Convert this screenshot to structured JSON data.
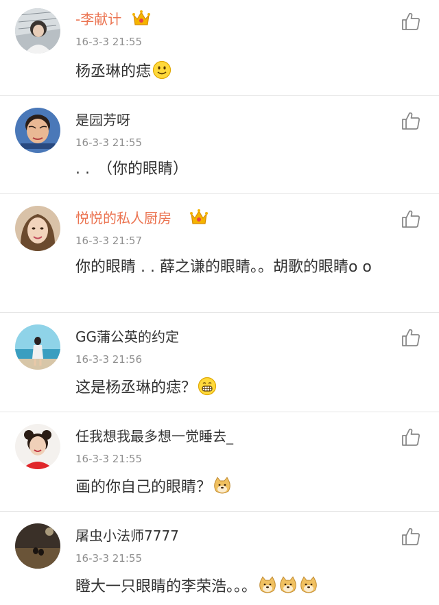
{
  "comments": [
    {
      "username": "-李献计",
      "vip": true,
      "timestamp": "16-3-3 21:55",
      "text": "杨丞琳的痣",
      "emoji": [
        "smile-emoji"
      ],
      "avatar_color": "#9aa3a8"
    },
    {
      "username": "是园芳呀",
      "vip": false,
      "timestamp": "16-3-3 21:55",
      "text": ". .　（你的眼睛）",
      "emoji": [],
      "avatar_color": "#6b8fbf"
    },
    {
      "username": "悦悦的私人厨房",
      "vip": true,
      "timestamp": "16-3-3 21:57",
      "text": "你的眼睛 . . 薛之谦的眼睛。。胡歌的眼睛o o",
      "emoji": [],
      "avatar_color": "#c9a07a"
    },
    {
      "username": "GG蒲公英的约定",
      "vip": false,
      "timestamp": "16-3-3 21:56",
      "text": "这是杨丞琳的痣？",
      "emoji": [
        "grin-emoji"
      ],
      "avatar_color": "#5fb2c7"
    },
    {
      "username": "任我想我最多想一觉睡去_",
      "vip": false,
      "timestamp": "16-3-3 21:55",
      "text": "画的你自己的眼睛？",
      "emoji": [
        "doge-emoji"
      ],
      "avatar_color": "#e04a3a"
    },
    {
      "username": "屠虫小法师7777",
      "vip": false,
      "timestamp": "16-3-3 21:55",
      "text": "瞪大一只眼睛的李荣浩。。。",
      "emoji": [
        "doge-emoji",
        "doge-emoji",
        "doge-emoji"
      ],
      "avatar_color": "#5a4a3a"
    }
  ],
  "colors": {
    "vip_name": "#eb7350",
    "name": "#333333",
    "timestamp": "#8f8f8f",
    "divider": "#e6e6e6"
  },
  "icons": {
    "like": "thumbs-up-icon",
    "vip": "crown-icon"
  }
}
